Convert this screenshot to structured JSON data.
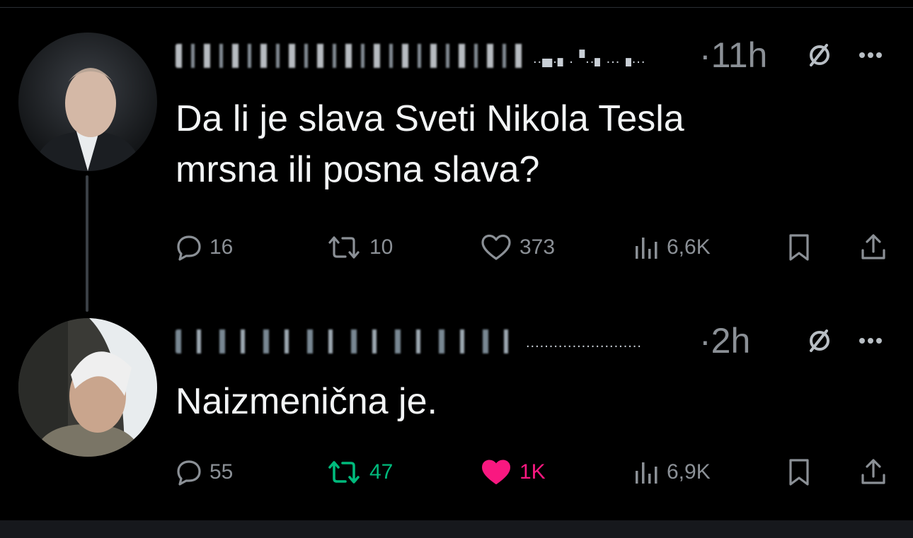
{
  "tweets": [
    {
      "text": "Da li je slava Sveti Nikola Tesla\nmrsna ili posna slava?",
      "time": "·11h",
      "counts": {
        "replies": "16",
        "retweets": "10",
        "likes": "373",
        "views": "6,6K"
      },
      "retweeted": false,
      "liked": false
    },
    {
      "text": "Naizmenična je.",
      "time": "·2h",
      "counts": {
        "replies": "55",
        "retweets": "47",
        "likes": "1K",
        "views": "6,9K"
      },
      "retweeted": true,
      "liked": true
    }
  ],
  "icons": {
    "reply": "reply-icon",
    "retweet": "retweet-icon",
    "like": "heart-icon",
    "views": "views-chart-icon",
    "bookmark": "bookmark-icon",
    "share": "share-icon",
    "grok": "grok-icon",
    "more": "more-dots-icon"
  },
  "colors": {
    "background": "#000000",
    "muted": "#8b9096",
    "retweet_active": "#00ba7c",
    "like_active": "#f91880",
    "thread_line": "#3a3f45"
  }
}
